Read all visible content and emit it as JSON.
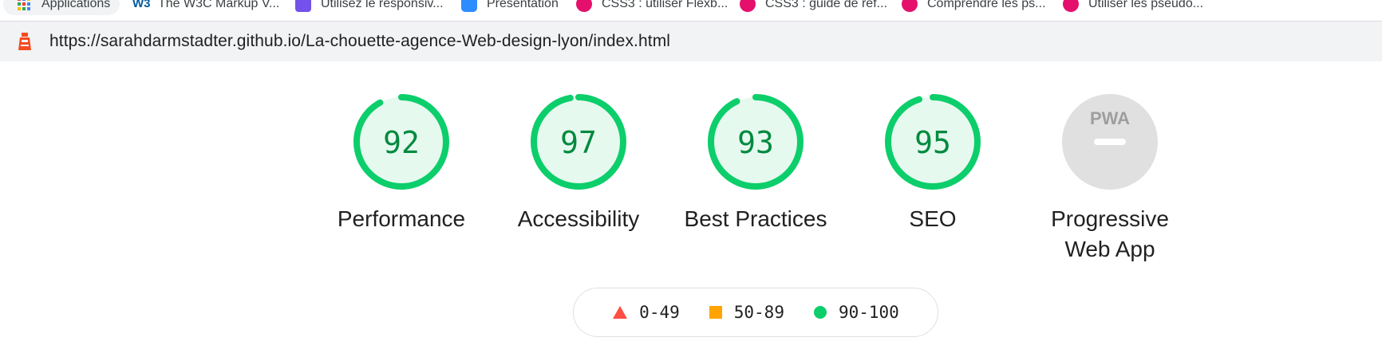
{
  "bookmarks": [
    {
      "label": "Applications",
      "icon": "apps-grid-icon"
    },
    {
      "label": "The W3C Markup V...",
      "icon": "w3c-icon"
    },
    {
      "label": "Utilisez le responsiv...",
      "icon": "openclassrooms-icon"
    },
    {
      "label": "Présentation",
      "icon": "zoom-camera-icon"
    },
    {
      "label": "CSS3 : utiliser Flexb...",
      "icon": "alert-pink-icon"
    },
    {
      "label": "CSS3 : guide de réf...",
      "icon": "alert-pink-icon"
    },
    {
      "label": "Comprendre les ps...",
      "icon": "alert-pink-icon"
    },
    {
      "label": "Utiliser les pseudo...",
      "icon": "alert-pink-icon"
    }
  ],
  "url": "https://sarahdarmstadter.github.io/La-chouette-agence-Web-design-lyon/index.html",
  "categories": [
    {
      "score": "92",
      "value": 92,
      "label": "Performance"
    },
    {
      "score": "97",
      "value": 97,
      "label": "Accessibility"
    },
    {
      "score": "93",
      "value": 93,
      "label": "Best Practices"
    },
    {
      "score": "95",
      "value": 95,
      "label": "SEO"
    }
  ],
  "pwa": {
    "badge": "PWA",
    "label_line1": "Progressive",
    "label_line2": "Web App"
  },
  "legend": [
    {
      "range": "0-49",
      "shape": "triangle",
      "color": "#ff4e42"
    },
    {
      "range": "50-89",
      "shape": "square",
      "color": "#ffa400"
    },
    {
      "range": "90-100",
      "shape": "circle",
      "color": "#0cce6b"
    }
  ],
  "colors": {
    "pass": "#0cce6b",
    "pass_fill": "#e6f9ef",
    "score_text": "#008a3e",
    "pwa_gray": "#e0e0e0"
  }
}
